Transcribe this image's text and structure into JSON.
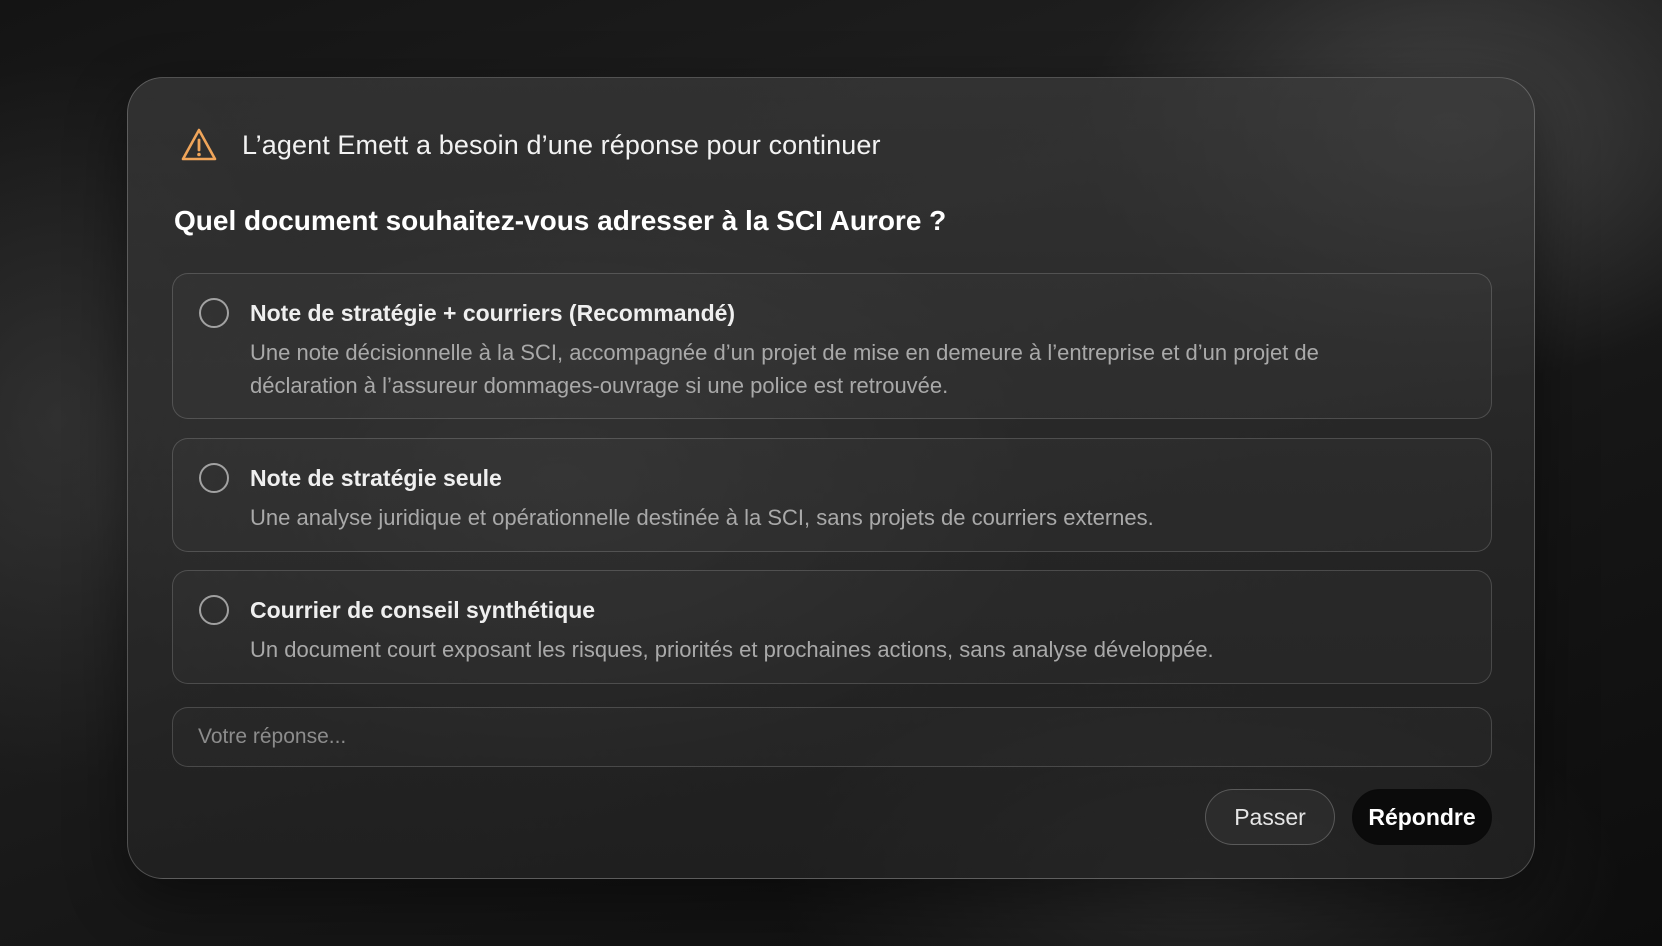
{
  "header": {
    "icon": "warning-icon",
    "text": "L’agent Emett a besoin d’une réponse pour continuer",
    "icon_color": "#f0a55a"
  },
  "question": "Quel document souhaitez-vous adresser à la SCI Aurore ?",
  "options": [
    {
      "title": "Note de stratégie + courriers (Recommandé)",
      "description": "Une note décisionnelle à la SCI, accompagnée d’un projet de mise en demeure à l’entreprise et d’un projet de déclaration à l’assureur dommages-ouvrage si une police est retrouvée."
    },
    {
      "title": "Note de stratégie seule",
      "description": "Une analyse juridique et opérationnelle destinée à la SCI, sans projets de courriers externes."
    },
    {
      "title": "Courrier de conseil synthétique",
      "description": "Un document court exposant les risques, priorités et prochaines actions, sans analyse développée."
    }
  ],
  "answer": {
    "placeholder": "Votre réponse...",
    "value": ""
  },
  "buttons": {
    "skip_label": "Passer",
    "reply_label": "Répondre"
  }
}
